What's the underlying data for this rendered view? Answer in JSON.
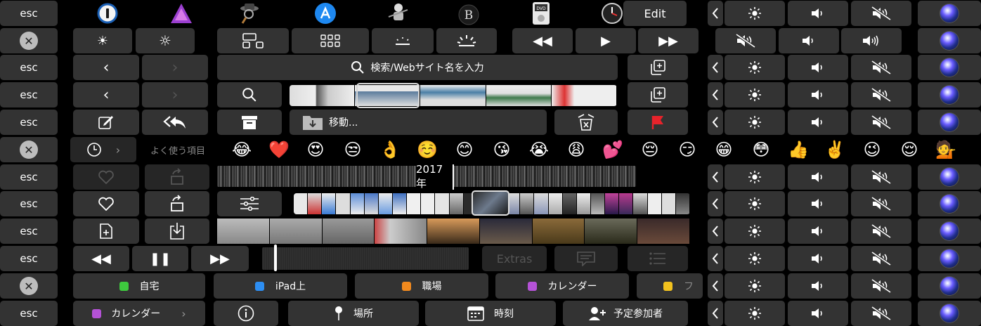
{
  "esc_label": "esc",
  "edit_label": "Edit",
  "safari": {
    "search_placeholder": "検索/Webサイト名を入力"
  },
  "mail": {
    "move_label": "移動..."
  },
  "emoji_bar": {
    "frequent_label": "よく使う項目",
    "emojis": [
      "😂",
      "❤️",
      "😍",
      "😒",
      "👌",
      "☺️",
      "😊",
      "😘",
      "😭",
      "😩",
      "💕",
      "😔",
      "😏",
      "😁",
      "😳",
      "👍",
      "✌️",
      "😉",
      "😌",
      "💁"
    ]
  },
  "photos": {
    "year_label": "2017 年"
  },
  "video": {
    "extras_label": "Extras"
  },
  "reminders": {
    "lists": [
      {
        "label": "自宅",
        "color": "#3ec93e"
      },
      {
        "label": "iPad上",
        "color": "#2d8ef2"
      },
      {
        "label": "職場",
        "color": "#f28a1e"
      },
      {
        "label": "カレンダー",
        "color": "#b452d6"
      },
      {
        "label": "フ",
        "color": "#f2c21e"
      }
    ]
  },
  "calendar_event": {
    "calendar_label": "カレンダー",
    "calendar_color": "#b452d6",
    "location_label": "場所",
    "time_label": "時刻",
    "invitees_label": "予定参加者"
  },
  "control_strip": {
    "icons": [
      "chevron-left-icon",
      "brightness-icon",
      "volume-icon",
      "mute-icon",
      "siri-icon"
    ]
  },
  "app_icons": [
    "1password-icon",
    "affinity-photo-icon",
    "alfred-icon",
    "app-store-icon",
    "automator-icon",
    "bbedit-icon",
    "dvd-player-icon",
    "clock-icon"
  ]
}
